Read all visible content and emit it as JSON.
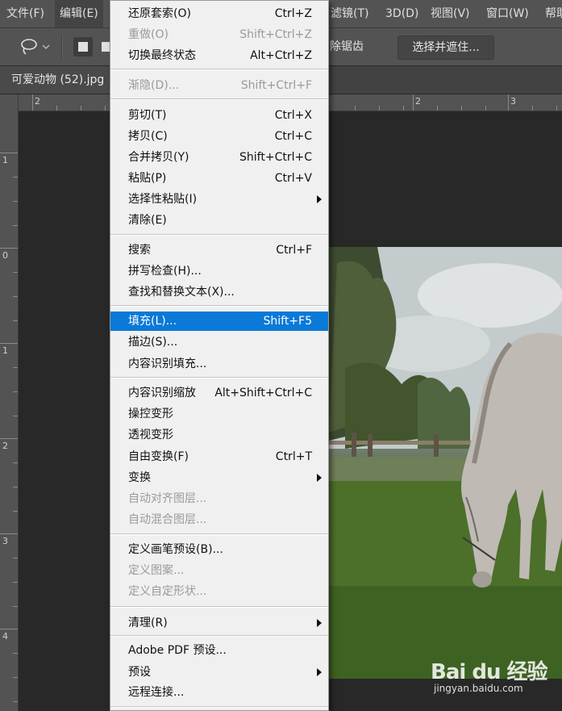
{
  "menubar": {
    "items": [
      {
        "label": "文件(F)"
      },
      {
        "label": "编辑(E)"
      },
      {
        "label": "滤镜(T)"
      },
      {
        "label": "3D(D)"
      },
      {
        "label": "视图(V)"
      },
      {
        "label": "窗口(W)"
      },
      {
        "label": "帮助"
      }
    ]
  },
  "options": {
    "remove_jaggies": "除锯齿",
    "select_and_mask": "选择并遮住..."
  },
  "document": {
    "tab_title": "可爱动物 (52).jpg"
  },
  "rulers": {
    "top_labels": [
      "2",
      "2",
      "3"
    ],
    "left_labels": [
      "1",
      "0",
      "1",
      "2",
      "3",
      "4"
    ]
  },
  "edit_menu": {
    "items": [
      {
        "label": "还原套索(O)",
        "shortcut": "Ctrl+Z",
        "state": "normal"
      },
      {
        "label": "重做(O)",
        "shortcut": "Shift+Ctrl+Z",
        "state": "disabled"
      },
      {
        "label": "切换最终状态",
        "shortcut": "Alt+Ctrl+Z",
        "state": "normal"
      },
      {
        "label": "渐隐(D)...",
        "shortcut": "Shift+Ctrl+F",
        "state": "disabled"
      },
      {
        "label": "剪切(T)",
        "shortcut": "Ctrl+X",
        "state": "normal"
      },
      {
        "label": "拷贝(C)",
        "shortcut": "Ctrl+C",
        "state": "normal"
      },
      {
        "label": "合并拷贝(Y)",
        "shortcut": "Shift+Ctrl+C",
        "state": "normal"
      },
      {
        "label": "粘贴(P)",
        "shortcut": "Ctrl+V",
        "state": "normal"
      },
      {
        "label": "选择性粘贴(I)",
        "shortcut": "",
        "state": "submenu"
      },
      {
        "label": "清除(E)",
        "shortcut": "",
        "state": "normal"
      },
      {
        "label": "搜索",
        "shortcut": "Ctrl+F",
        "state": "normal"
      },
      {
        "label": "拼写检查(H)...",
        "shortcut": "",
        "state": "normal"
      },
      {
        "label": "查找和替换文本(X)...",
        "shortcut": "",
        "state": "normal"
      },
      {
        "label": "填充(L)...",
        "shortcut": "Shift+F5",
        "state": "highlighted"
      },
      {
        "label": "描边(S)...",
        "shortcut": "",
        "state": "normal"
      },
      {
        "label": "内容识别填充...",
        "shortcut": "",
        "state": "normal"
      },
      {
        "label": "内容识别缩放",
        "shortcut": "Alt+Shift+Ctrl+C",
        "state": "normal"
      },
      {
        "label": "操控变形",
        "shortcut": "",
        "state": "normal"
      },
      {
        "label": "透视变形",
        "shortcut": "",
        "state": "normal"
      },
      {
        "label": "自由变换(F)",
        "shortcut": "Ctrl+T",
        "state": "normal"
      },
      {
        "label": "变换",
        "shortcut": "",
        "state": "submenu"
      },
      {
        "label": "自动对齐图层...",
        "shortcut": "",
        "state": "disabled"
      },
      {
        "label": "自动混合图层...",
        "shortcut": "",
        "state": "disabled"
      },
      {
        "label": "定义画笔预设(B)...",
        "shortcut": "",
        "state": "normal"
      },
      {
        "label": "定义图案...",
        "shortcut": "",
        "state": "disabled"
      },
      {
        "label": "定义自定形状...",
        "shortcut": "",
        "state": "disabled"
      },
      {
        "label": "清理(R)",
        "shortcut": "",
        "state": "submenu"
      },
      {
        "label": "Adobe PDF 预设...",
        "shortcut": "",
        "state": "normal"
      },
      {
        "label": "预设",
        "shortcut": "",
        "state": "submenu"
      },
      {
        "label": "远程连接...",
        "shortcut": "",
        "state": "normal"
      }
    ]
  },
  "watermark": {
    "brand": "Bai du 经验",
    "url": "jingyan.baidu.com"
  }
}
